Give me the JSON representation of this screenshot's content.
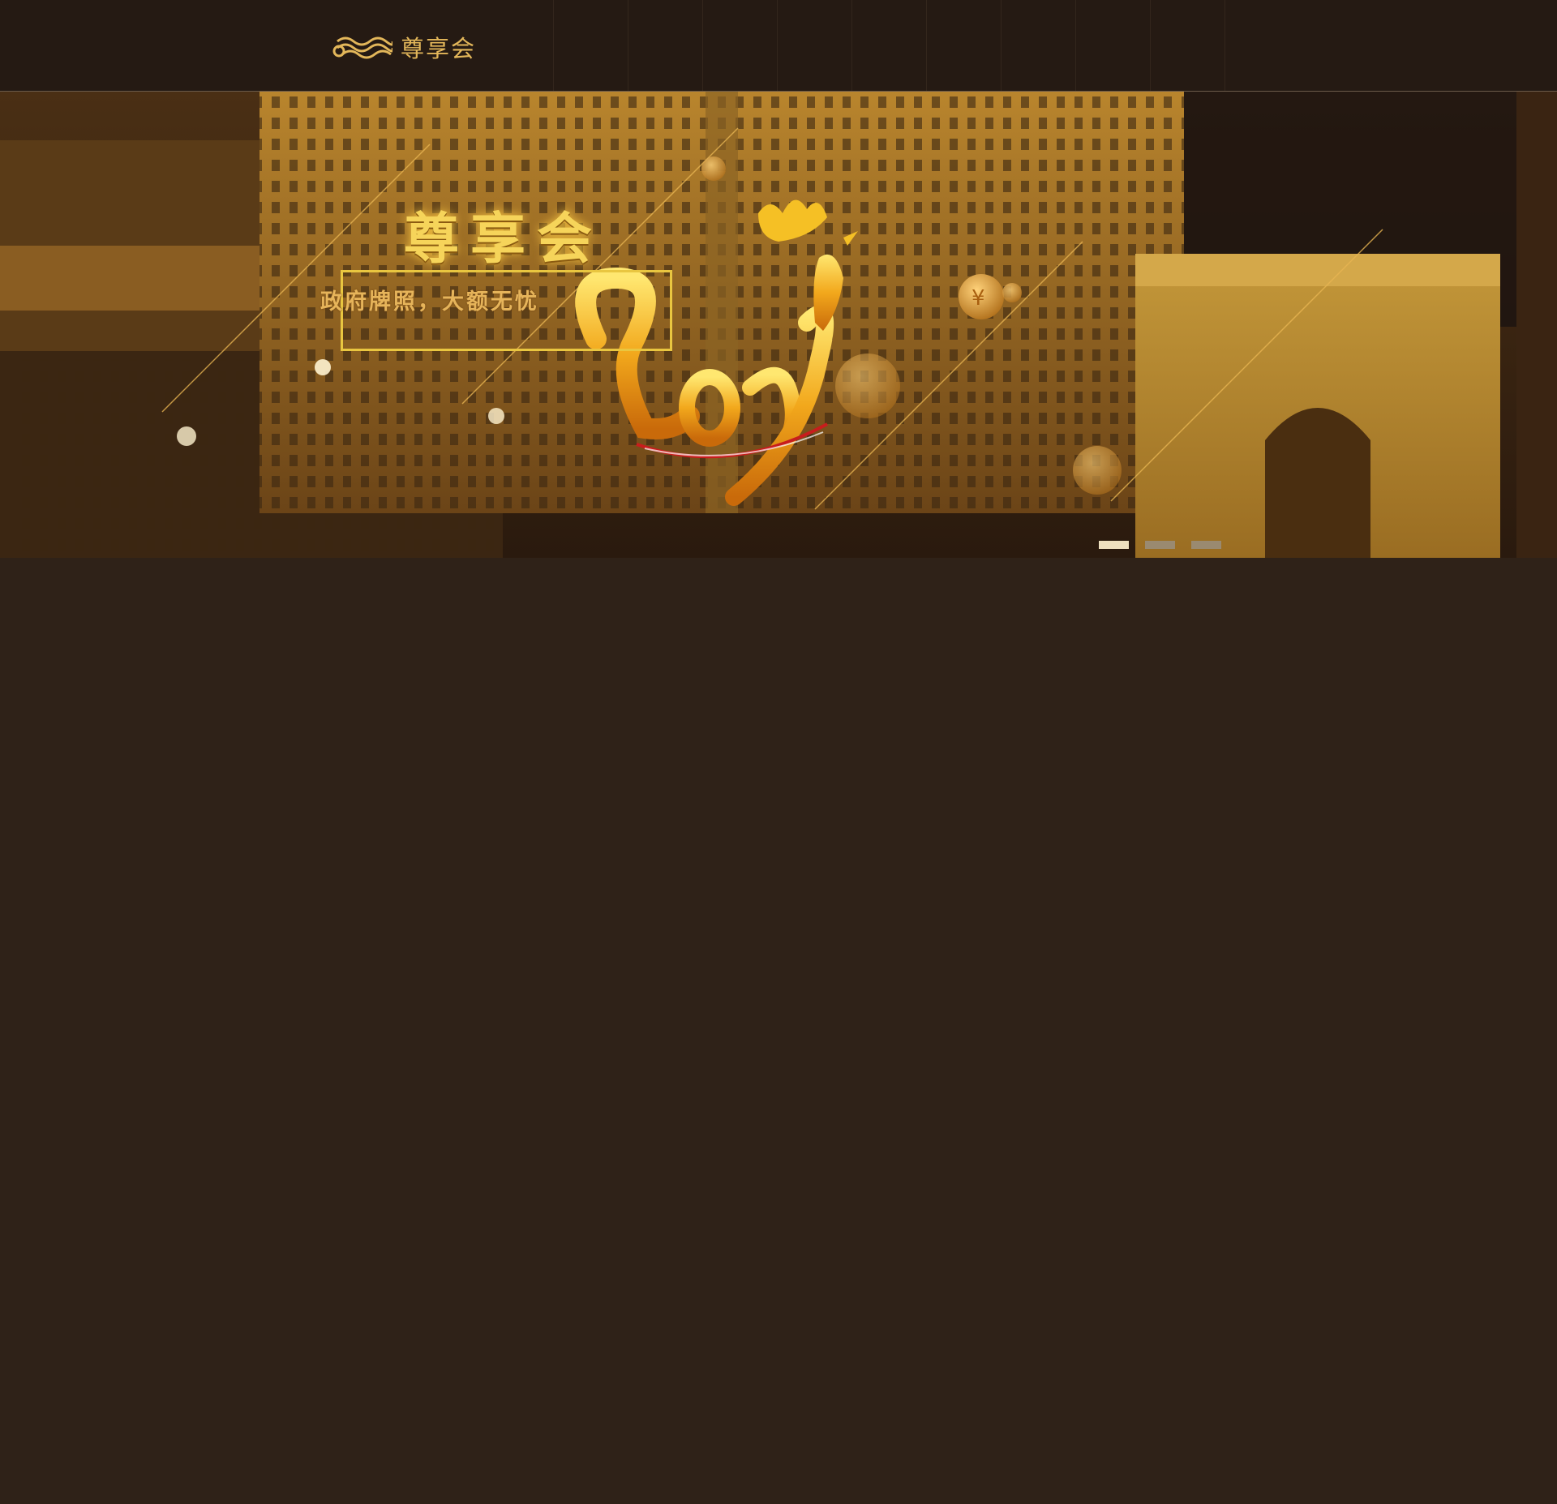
{
  "header": {
    "logo_text": "尊享会",
    "nav_items": [
      "",
      "",
      "",
      "",
      "",
      "",
      "",
      "",
      "",
      ""
    ]
  },
  "banner": {
    "brand_title": "尊享会",
    "slogan": "政府牌照，大额无忧",
    "year_art": "2017",
    "slide_count": 3,
    "active_slide": 1
  },
  "colors": {
    "header_bg": "#251a13",
    "page_bg": "#2f2218",
    "gold": "#e3b75a",
    "dot_active": "#eee0bf",
    "dot_inactive": "#9a8a70"
  }
}
